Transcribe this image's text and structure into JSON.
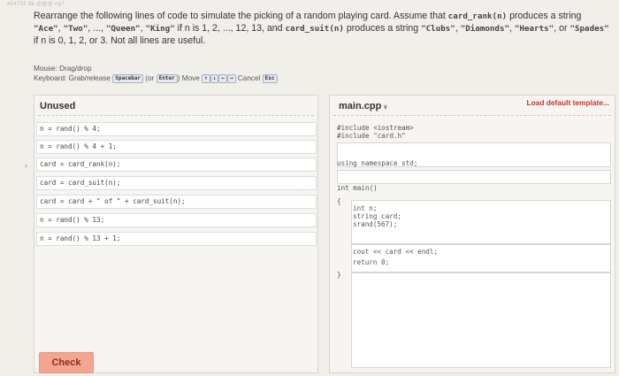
{
  "watermark": "454792 36 @@@ ng?",
  "prompt": {
    "p1": "Rearrange the following lines of code to simulate the picking of a random playing card. Assume that ",
    "c1": "card_rank(n)",
    "p2": " produces a string ",
    "c2": "\"Ace\"",
    "p3": ", ",
    "c3": "\"Two\"",
    "p4": ", ..., ",
    "c4": "\"Queen\"",
    "p5": ", ",
    "c5": "\"King\"",
    "p6": " if n is 1, 2, ..., 12, 13, and ",
    "c6": "card_suit(n)",
    "p7": " produces a string ",
    "c7": "\"Clubs\"",
    "p8": ", ",
    "c8": "\"Diamonds\"",
    "p9": ", ",
    "c9": "\"Hearts\"",
    "p10": ", or ",
    "c10": "\"Spades\"",
    "p11": " if n is 0, 1, 2, or 3. Not all lines are useful."
  },
  "instructions": {
    "mouse": "Mouse: Drag/drop",
    "kb_label": "Keyboard: Grab/release",
    "kb_space": "Spacebar",
    "kb_or": "(or",
    "kb_enter": "Enter",
    "kb_close": ")",
    "move_label": "Move",
    "move_keys": [
      "↑",
      "↓",
      "←",
      "→"
    ],
    "cancel_label": "Cancel",
    "cancel_key": "Esc"
  },
  "unused": {
    "title": "Unused",
    "lines": [
      "n = rand() % 4;",
      "n = rand() % 4 + 1;",
      "card = card_rank(n);",
      "card = card_suit(n);",
      "card = card + \" of \" + card_suit(n);",
      "n = rand() % 13;",
      "n = rand() % 13 + 1;"
    ]
  },
  "editor": {
    "file": "main.cpp",
    "load_default": "Load default template...",
    "code": {
      "inc1": "#include <iostream>",
      "inc2": "#include \"card.h\"",
      "using": "using namespace std;",
      "main": "int main()",
      "open": "{",
      "decl1": "int n;",
      "decl2": "string card;",
      "srand": "srand(567);",
      "cout": "cout << card << endl;",
      "ret": "return 0;",
      "close": "}"
    }
  },
  "check_label": "Check"
}
